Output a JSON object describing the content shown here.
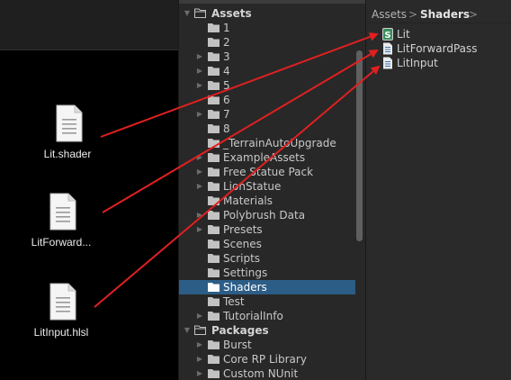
{
  "explorer": {
    "files": [
      {
        "name": "Lit.shader"
      },
      {
        "name": "LitForward..."
      },
      {
        "name": "LitInput.hlsl"
      }
    ]
  },
  "project_tree": {
    "rows": [
      {
        "label": "Assets",
        "kind": "header",
        "expanded": true
      },
      {
        "label": "1",
        "kind": "folder"
      },
      {
        "label": "2",
        "kind": "folder"
      },
      {
        "label": "3",
        "kind": "folder",
        "arrow": true
      },
      {
        "label": "4",
        "kind": "folder",
        "arrow": true
      },
      {
        "label": "5",
        "kind": "folder",
        "arrow": true
      },
      {
        "label": "6",
        "kind": "folder"
      },
      {
        "label": "7",
        "kind": "folder",
        "arrow": true
      },
      {
        "label": "8",
        "kind": "folder"
      },
      {
        "label": "_TerrainAutoUpgrade",
        "kind": "folder"
      },
      {
        "label": "ExampleAssets",
        "kind": "folder",
        "arrow": true
      },
      {
        "label": "Free Statue Pack",
        "kind": "folder",
        "arrow": true
      },
      {
        "label": "LionStatue",
        "kind": "folder",
        "arrow": true
      },
      {
        "label": "Materials",
        "kind": "folder"
      },
      {
        "label": "Polybrush Data",
        "kind": "folder",
        "arrow": true
      },
      {
        "label": "Presets",
        "kind": "folder",
        "arrow": true
      },
      {
        "label": "Scenes",
        "kind": "folder"
      },
      {
        "label": "Scripts",
        "kind": "folder"
      },
      {
        "label": "Settings",
        "kind": "folder"
      },
      {
        "label": "Shaders",
        "kind": "folder",
        "selected": true
      },
      {
        "label": "Test",
        "kind": "folder"
      },
      {
        "label": "TutorialInfo",
        "kind": "folder",
        "arrow": true
      },
      {
        "label": "Packages",
        "kind": "header",
        "expanded": true
      },
      {
        "label": "Burst",
        "kind": "folder",
        "arrow": true
      },
      {
        "label": "Core RP Library",
        "kind": "folder",
        "arrow": true
      },
      {
        "label": "Custom NUnit",
        "kind": "folder",
        "arrow": true
      }
    ]
  },
  "breadcrumb": {
    "root": "Assets",
    "separator": ">",
    "current": "Shaders",
    "trailing": ">"
  },
  "assets": [
    {
      "label": "Lit",
      "icon": "shader-icon"
    },
    {
      "label": "LitForwardPass",
      "icon": "script-file-icon"
    },
    {
      "label": "LitInput",
      "icon": "script-file-icon"
    }
  ],
  "colors": {
    "arrow": "#e02020",
    "selection": "#2c5d87",
    "folder": "#c2c2c2"
  }
}
